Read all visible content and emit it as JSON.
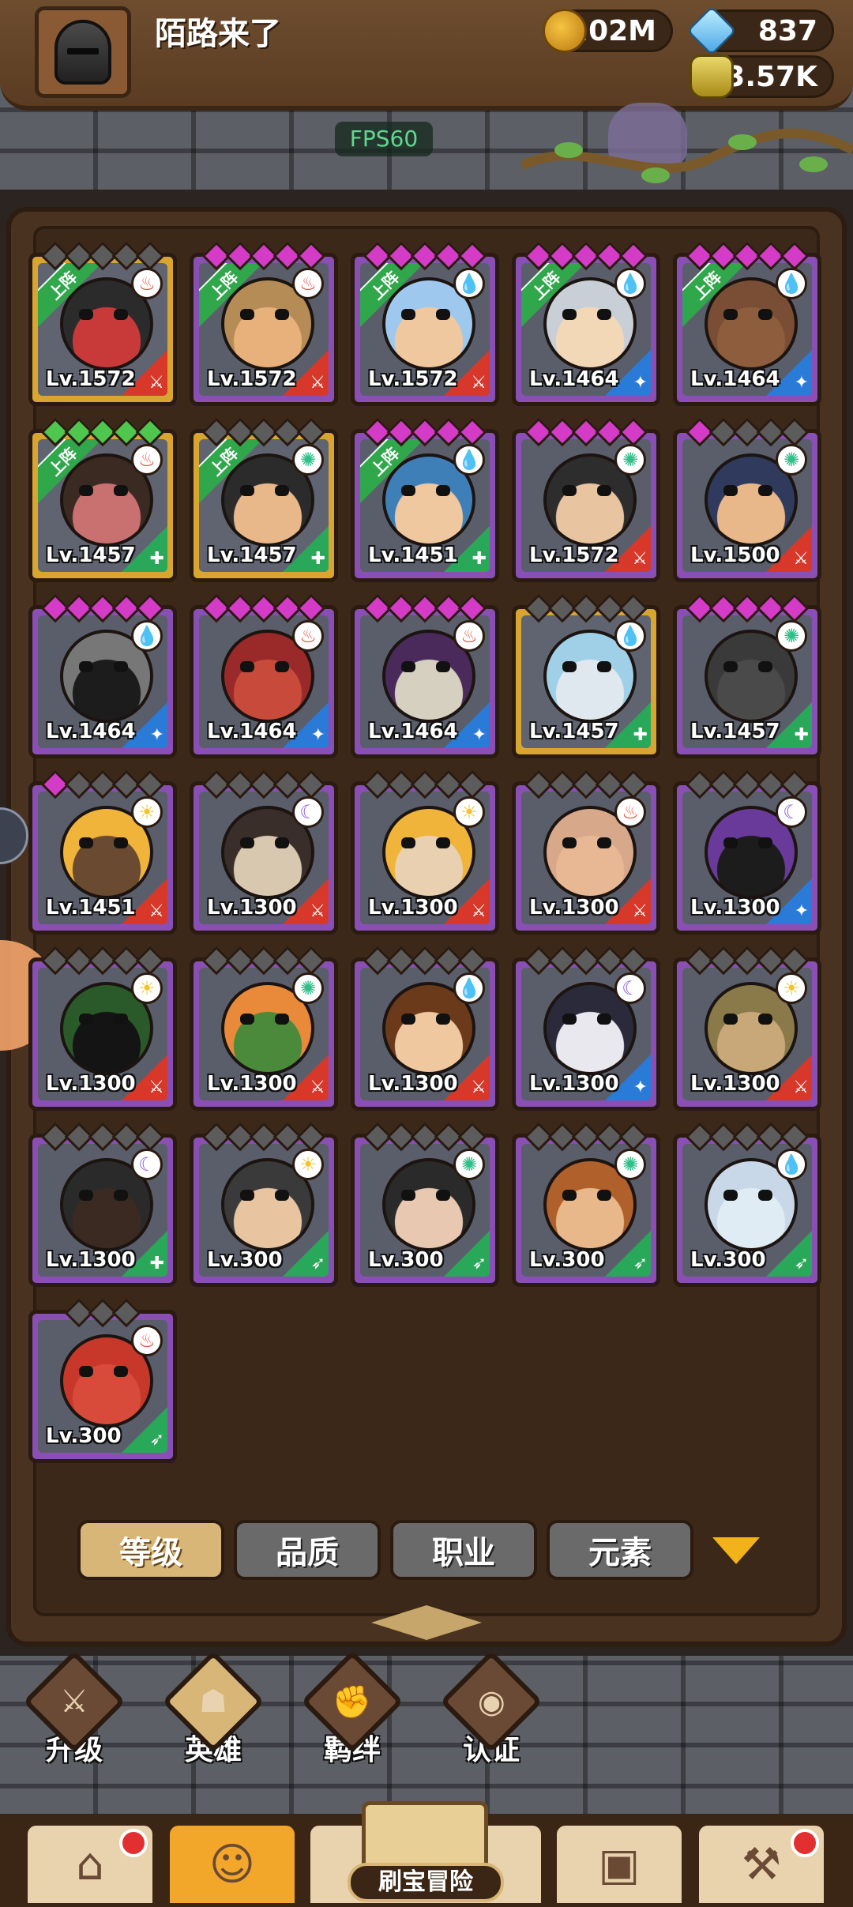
{
  "header": {
    "username": "陌路来了",
    "gold": "1.02M",
    "gems": "837",
    "potion": "3.57K",
    "fps": "FPS60"
  },
  "heroes": [
    {
      "level": "Lv.1572",
      "deployed": true,
      "frame": "gold",
      "stars": [
        "gray",
        "gray",
        "gray",
        "gray",
        "gray"
      ],
      "element": "fire",
      "role": "sword",
      "face": "#2b2b2b",
      "skin": "#c83a3a"
    },
    {
      "level": "Lv.1572",
      "deployed": true,
      "frame": "purple",
      "stars": [
        "pink",
        "pink",
        "pink",
        "pink",
        "pink"
      ],
      "element": "fire",
      "role": "sword",
      "face": "#b58b56",
      "skin": "#e8b07a"
    },
    {
      "level": "Lv.1572",
      "deployed": true,
      "frame": "purple",
      "stars": [
        "pink",
        "pink",
        "pink",
        "pink",
        "pink"
      ],
      "element": "water",
      "role": "sword",
      "face": "#9ec8ee",
      "skin": "#f0c8a0"
    },
    {
      "level": "Lv.1464",
      "deployed": true,
      "frame": "purple",
      "stars": [
        "pink",
        "pink",
        "pink",
        "pink",
        "pink"
      ],
      "element": "water",
      "role": "staff",
      "face": "#c9cfd6",
      "skin": "#f3d8b8"
    },
    {
      "level": "Lv.1464",
      "deployed": true,
      "frame": "purple",
      "stars": [
        "pink",
        "pink",
        "pink",
        "pink",
        "pink"
      ],
      "element": "water",
      "role": "staff",
      "face": "#7a4e34",
      "skin": "#8e5d3e"
    },
    {
      "level": "Lv.1457",
      "deployed": true,
      "frame": "gold",
      "stars": [
        "green",
        "green",
        "green",
        "green",
        "green"
      ],
      "element": "fire",
      "role": "shield",
      "face": "#3a2a22",
      "skin": "#c97070"
    },
    {
      "level": "Lv.1457",
      "deployed": true,
      "frame": "gold",
      "stars": [
        "gray",
        "gray",
        "gray",
        "gray",
        "gray"
      ],
      "element": "wind",
      "role": "shield",
      "face": "#2b2b2b",
      "skin": "#e8b88a"
    },
    {
      "level": "Lv.1451",
      "deployed": true,
      "frame": "purple",
      "stars": [
        "pink",
        "pink",
        "pink",
        "pink",
        "pink"
      ],
      "element": "water",
      "role": "shield",
      "face": "#3f7fb8",
      "skin": "#f0c8a0"
    },
    {
      "level": "Lv.1572",
      "deployed": false,
      "frame": "purple",
      "stars": [
        "pink",
        "pink",
        "pink",
        "pink",
        "pink"
      ],
      "element": "wind",
      "role": "sword",
      "face": "#2d2d2d",
      "skin": "#e8c4a0"
    },
    {
      "level": "Lv.1500",
      "deployed": false,
      "frame": "purple",
      "stars": [
        "pink",
        "gray",
        "gray",
        "gray",
        "gray"
      ],
      "element": "wind",
      "role": "sword",
      "face": "#2f3a5c",
      "skin": "#e8b88a"
    },
    {
      "level": "Lv.1464",
      "deployed": false,
      "frame": "purple",
      "stars": [
        "pink",
        "pink",
        "pink",
        "pink",
        "pink"
      ],
      "element": "water",
      "role": "staff",
      "face": "#777777",
      "skin": "#1c1c1c"
    },
    {
      "level": "Lv.1464",
      "deployed": false,
      "frame": "purple",
      "stars": [
        "pink",
        "pink",
        "pink",
        "pink",
        "pink"
      ],
      "element": "fire",
      "role": "staff",
      "face": "#9a2a2a",
      "skin": "#c84a3a"
    },
    {
      "level": "Lv.1464",
      "deployed": false,
      "frame": "purple",
      "stars": [
        "pink",
        "pink",
        "pink",
        "pink",
        "pink"
      ],
      "element": "fire",
      "role": "staff",
      "face": "#4a2a5a",
      "skin": "#d6d0c0"
    },
    {
      "level": "Lv.1457",
      "deployed": false,
      "frame": "gold",
      "stars": [
        "gray",
        "gray",
        "gray",
        "gray",
        "gray"
      ],
      "element": "water",
      "role": "shield",
      "face": "#9fd0e8",
      "skin": "#dfe8ee"
    },
    {
      "level": "Lv.1457",
      "deployed": false,
      "frame": "purple",
      "stars": [
        "pink",
        "pink",
        "pink",
        "pink",
        "pink"
      ],
      "element": "wind",
      "role": "shield",
      "face": "#3a3a3a",
      "skin": "#4a4a4a"
    },
    {
      "level": "Lv.1451",
      "deployed": false,
      "frame": "purple",
      "stars": [
        "pink",
        "gray",
        "gray",
        "gray",
        "gray"
      ],
      "element": "light",
      "role": "sword",
      "face": "#f0b43a",
      "skin": "#6a4a30"
    },
    {
      "level": "Lv.1300",
      "deployed": false,
      "frame": "purple",
      "stars": [
        "gray",
        "gray",
        "gray",
        "gray",
        "gray"
      ],
      "element": "dark",
      "role": "sword",
      "face": "#3a2e2a",
      "skin": "#d8c8b0"
    },
    {
      "level": "Lv.1300",
      "deployed": false,
      "frame": "purple",
      "stars": [
        "gray",
        "gray",
        "gray",
        "gray",
        "gray"
      ],
      "element": "light",
      "role": "sword",
      "face": "#f0b43a",
      "skin": "#e8d0b0"
    },
    {
      "level": "Lv.1300",
      "deployed": false,
      "frame": "purple",
      "stars": [
        "gray",
        "gray",
        "gray",
        "gray",
        "gray"
      ],
      "element": "fire",
      "role": "sword",
      "face": "#d8a88a",
      "skin": "#e8b894"
    },
    {
      "level": "Lv.1300",
      "deployed": false,
      "frame": "purple",
      "stars": [
        "gray",
        "gray",
        "gray",
        "gray",
        "gray"
      ],
      "element": "dark",
      "role": "staff",
      "face": "#6a3a9a",
      "skin": "#1c1c1c"
    },
    {
      "level": "Lv.1300",
      "deployed": false,
      "frame": "purple",
      "stars": [
        "gray",
        "gray",
        "gray",
        "gray",
        "gray"
      ],
      "element": "light",
      "role": "sword",
      "face": "#2a5a2a",
      "skin": "#141414"
    },
    {
      "level": "Lv.1300",
      "deployed": false,
      "frame": "purple",
      "stars": [
        "gray",
        "gray",
        "gray",
        "gray",
        "gray"
      ],
      "element": "wind",
      "role": "sword",
      "face": "#e88a3a",
      "skin": "#4a8a3a"
    },
    {
      "level": "Lv.1300",
      "deployed": false,
      "frame": "purple",
      "stars": [
        "gray",
        "gray",
        "gray",
        "gray",
        "gray"
      ],
      "element": "water",
      "role": "sword",
      "face": "#6a3a1a",
      "skin": "#f0c8a0"
    },
    {
      "level": "Lv.1300",
      "deployed": false,
      "frame": "purple",
      "stars": [
        "gray",
        "gray",
        "gray",
        "gray",
        "gray"
      ],
      "element": "dark",
      "role": "staff",
      "face": "#2a2a3a",
      "skin": "#e8e8ee"
    },
    {
      "level": "Lv.1300",
      "deployed": false,
      "frame": "purple",
      "stars": [
        "gray",
        "gray",
        "gray",
        "gray",
        "gray"
      ],
      "element": "light",
      "role": "sword",
      "face": "#8a7a4a",
      "skin": "#c8a878"
    },
    {
      "level": "Lv.1300",
      "deployed": false,
      "frame": "purple",
      "stars": [
        "gray",
        "gray",
        "gray",
        "gray",
        "gray"
      ],
      "element": "dark",
      "role": "shield",
      "face": "#2a2a2a",
      "skin": "#3a2a22"
    },
    {
      "level": "Lv.300",
      "deployed": false,
      "frame": "purple",
      "stars": [
        "gray",
        "gray",
        "gray",
        "gray",
        "gray"
      ],
      "element": "light",
      "role": "bow",
      "face": "#3a3a3a",
      "skin": "#e8c4a0"
    },
    {
      "level": "Lv.300",
      "deployed": false,
      "frame": "purple",
      "stars": [
        "gray",
        "gray",
        "gray",
        "gray",
        "gray"
      ],
      "element": "wind",
      "role": "bow",
      "face": "#2a2a2a",
      "skin": "#e8c8b0"
    },
    {
      "level": "Lv.300",
      "deployed": false,
      "frame": "purple",
      "stars": [
        "gray",
        "gray",
        "gray",
        "gray",
        "gray"
      ],
      "element": "wind",
      "role": "bow",
      "face": "#b0602a",
      "skin": "#e8b88a"
    },
    {
      "level": "Lv.300",
      "deployed": false,
      "frame": "purple",
      "stars": [
        "gray",
        "gray",
        "gray",
        "gray",
        "gray"
      ],
      "element": "water",
      "role": "bow",
      "face": "#c8d8e8",
      "skin": "#e0ecf4"
    },
    {
      "level": "Lv.300",
      "deployed": false,
      "frame": "purple",
      "stars": [
        "gray",
        "gray",
        "gray"
      ],
      "element": "fire",
      "role": "bow",
      "face": "#c8382a",
      "skin": "#d84a3a"
    }
  ],
  "deploy_label": "上阵",
  "filters": [
    {
      "label": "等级",
      "active": true
    },
    {
      "label": "品质",
      "active": false
    },
    {
      "label": "职业",
      "active": false
    },
    {
      "label": "元素",
      "active": false
    }
  ],
  "subnav": [
    {
      "label": "升级",
      "icon": "sword-upgrade-icon",
      "active": false
    },
    {
      "label": "英雄",
      "icon": "hero-icon",
      "active": true
    },
    {
      "label": "羁绊",
      "icon": "handshake-icon",
      "active": false
    },
    {
      "label": "认证",
      "icon": "eye-icon",
      "active": false
    }
  ],
  "bottom_nav": {
    "adventure_label": "刷宝冒险"
  },
  "colors": {
    "fire": "#e8483a",
    "water": "#3a8ee8",
    "wind": "#2fbf8a",
    "light": "#f2c32a",
    "dark": "#8a5ad8",
    "sword": "#d8382a",
    "staff": "#2a7ad8",
    "shield": "#2aa85a",
    "bow": "#2aa85a"
  }
}
